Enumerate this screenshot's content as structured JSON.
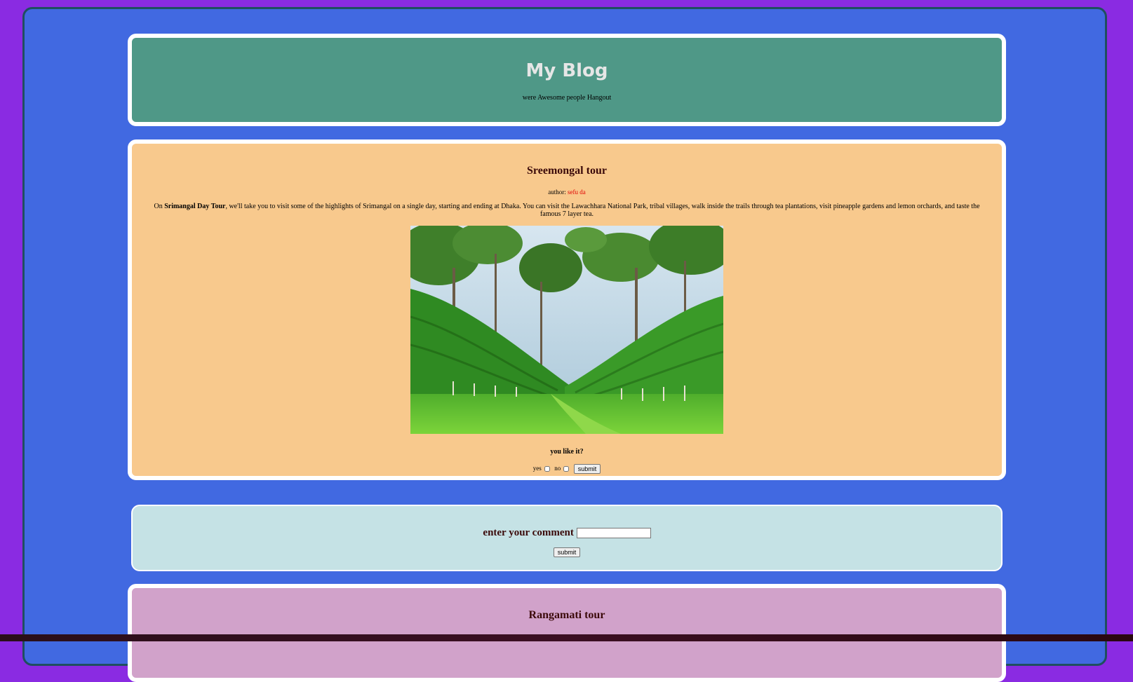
{
  "header": {
    "title": "My Blog",
    "tagline": "were Awesome people Hangout"
  },
  "post1": {
    "title": "Sreemongal tour",
    "author_label": "author:",
    "author_name": "sefu da",
    "desc_prefix": "On",
    "desc_bold": "Srimangal Day Tour",
    "desc_rest": ", we'll take you to visit some of the highlights of Srimangal on a single day, starting and ending at Dhaka. You can visit the Lawachhara National Park, tribal villages, walk inside the trails through tea plantations, visit pineapple gardens and lemon orchards, and taste the famous 7 layer tea.",
    "image_alt": "tea garden photo",
    "question": "you like it?",
    "yes_label": "yes",
    "no_label": "no",
    "submit_label": "submit"
  },
  "comment": {
    "label": "enter your comment",
    "input_value": "",
    "submit_label": "submit"
  },
  "post2": {
    "title": "Rangamati tour"
  },
  "colors": {
    "page_bg": "#8a2be2",
    "container_bg": "#4169e1",
    "header_bg": "#4f9887",
    "post1_bg": "#f8c98d",
    "comment_bg": "#c5e2e5",
    "post2_bg": "#d1a2ca",
    "author_name": "#e00000"
  }
}
